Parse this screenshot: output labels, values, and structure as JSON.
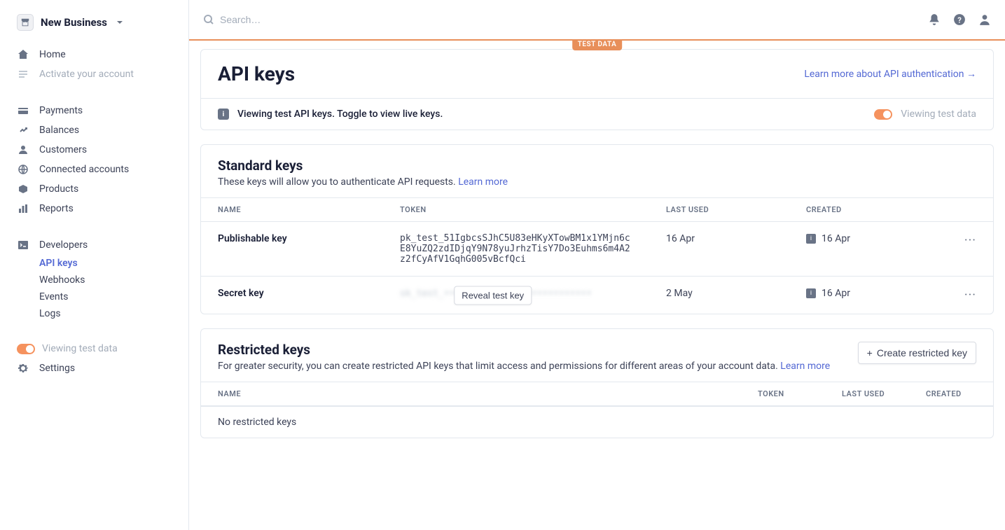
{
  "business_name": "New Business",
  "search_placeholder": "Search…",
  "test_badge": "TEST DATA",
  "sidebar": {
    "home": "Home",
    "activate": "Activate your account",
    "payments": "Payments",
    "balances": "Balances",
    "customers": "Customers",
    "connected": "Connected accounts",
    "products": "Products",
    "reports": "Reports",
    "developers": "Developers",
    "api_keys": "API keys",
    "webhooks": "Webhooks",
    "events": "Events",
    "logs": "Logs",
    "viewing_test": "Viewing test data",
    "settings": "Settings"
  },
  "header": {
    "title": "API keys",
    "learn_link": "Learn more about API authentication",
    "info_msg": "Viewing test API keys. Toggle to view live keys.",
    "toggle_label": "Viewing test data"
  },
  "standard": {
    "title": "Standard keys",
    "subtitle_pre": "These keys will allow you to authenticate API requests. ",
    "subtitle_link": "Learn more",
    "cols": {
      "name": "NAME",
      "token": "TOKEN",
      "last_used": "LAST USED",
      "created": "CREATED"
    },
    "rows": [
      {
        "name": "Publishable key",
        "token": "pk_test_51IgbcsSJhC5U83eHKyXTowBM1x1YMjn6cE8YuZQ2zdIDjqY9N78yuJrhzTisY7Do3Euhms6m4A2z2fCyAfV1GqhG005vBcfQci",
        "last_used": "16 Apr",
        "created": "16 Apr"
      },
      {
        "name": "Secret key",
        "token_hidden": true,
        "reveal_label": "Reveal test key",
        "last_used": "2 May",
        "created": "16 Apr"
      }
    ]
  },
  "restricted": {
    "title": "Restricted keys",
    "subtitle_pre": "For greater security, you can create restricted API keys that limit access and permissions for different areas of your account data. ",
    "subtitle_link": "Learn more",
    "create_btn": "Create restricted key",
    "cols": {
      "name": "NAME",
      "token": "TOKEN",
      "last_used": "LAST USED",
      "created": "CREATED"
    },
    "empty": "No restricted keys"
  }
}
